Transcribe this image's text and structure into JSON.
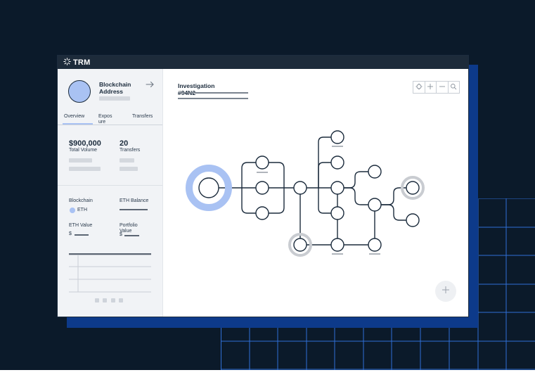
{
  "app": {
    "logo": "TRM"
  },
  "profile": {
    "title": "Blockchain Address"
  },
  "tabs": [
    "Overview",
    "Expos ure",
    "Transfers"
  ],
  "stats": {
    "total_volume": {
      "value": "$900,000",
      "label": "Total Volume"
    },
    "transfers": {
      "value": "20",
      "label": "Transfers"
    }
  },
  "details": {
    "blockchain_label": "Blockchain",
    "blockchain_value": "ETH",
    "eth_balance_label": "ETH Balance",
    "eth_value_label": "ETH Value",
    "eth_value_currency": "$",
    "portfolio_value_label": "Portfolio Value",
    "portfolio_value_currency": "$"
  },
  "investigation": {
    "title": "Investigation",
    "id": "#94N2"
  },
  "colors": {
    "accent": "#a9c2f3",
    "dark": "#1b2b3c",
    "brand_blue": "#0d3a8a",
    "grid_line": "#2f6fd6",
    "muted_ring": "#c9ccd1"
  },
  "icons": {
    "logo": "trm-logo-icon",
    "arrow": "arrow-right-icon",
    "toolbar": [
      "target-icon",
      "plus-icon",
      "minus-icon",
      "search-icon"
    ],
    "fab": "plus-icon"
  }
}
